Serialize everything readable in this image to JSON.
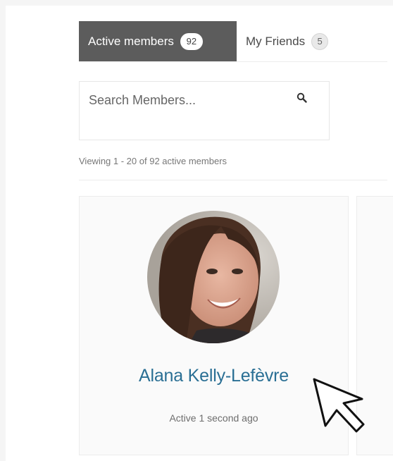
{
  "tabs": [
    {
      "label": "Active members",
      "count": "92"
    },
    {
      "label": "My Friends",
      "count": "5"
    }
  ],
  "search": {
    "placeholder": "Search Members..."
  },
  "viewing_text": "Viewing 1 - 20 of 92 active members",
  "members": [
    {
      "name": "Alana Kelly-Lefèvre",
      "status": "Active 1 second ago"
    }
  ],
  "colors": {
    "active_tab_bg": "#5c5c5c",
    "member_name": "#2a6f94"
  },
  "icons": {
    "search": "search-icon",
    "cursor": "mouse-pointer-icon"
  }
}
